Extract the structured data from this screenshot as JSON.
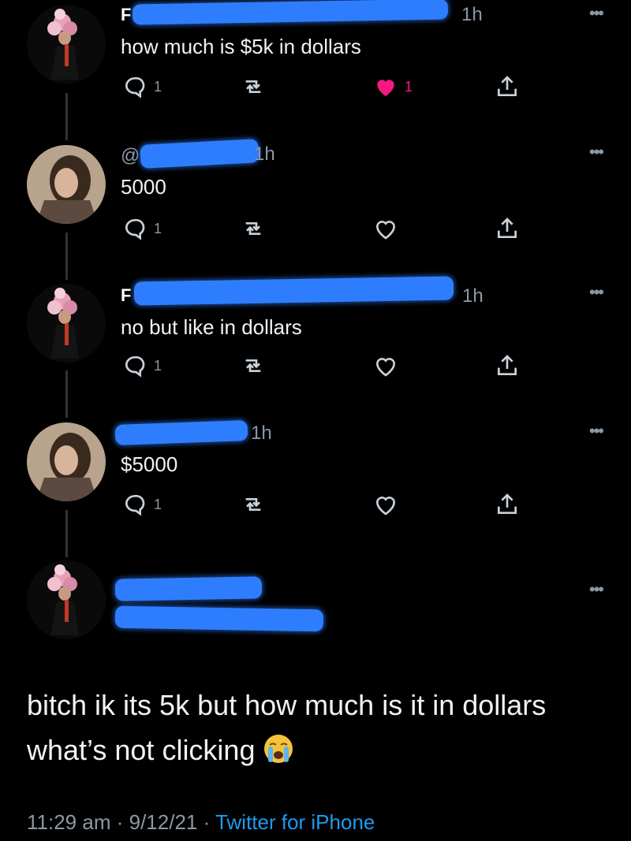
{
  "tweets": [
    {
      "name_fragment": "F",
      "time": "1h",
      "text": "how much is $5k in dollars",
      "reply_count": "1",
      "like_count": "1",
      "liked": true
    },
    {
      "handle_fragment": "@",
      "time": "1h",
      "text": "5000",
      "reply_count": "1"
    },
    {
      "name_fragment": "F",
      "time": "1h",
      "text": "no but like in dollars",
      "reply_count": "1"
    },
    {
      "time": "1h",
      "text": "$5000",
      "reply_count": "1"
    }
  ],
  "main_tweet": {
    "text": "bitch ik its 5k but how much is it in dollars what’s not clicking",
    "emoji": "loudly-crying-face",
    "time": "11:29 am",
    "date": "9/12/21",
    "source": "Twitter for iPhone",
    "sep": "·"
  },
  "colors": {
    "background": "#000000",
    "text": "#e7e9ea",
    "muted": "#8b98a5",
    "like": "#f91880",
    "link": "#1d9bf0",
    "redaction": "#2f7dff"
  }
}
